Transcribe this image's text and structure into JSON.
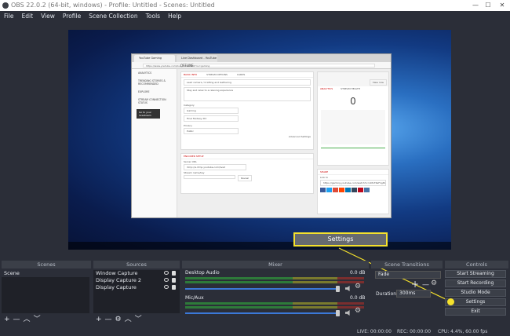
{
  "window": {
    "title": "OBS 22.0.2 (64-bit, windows) - Profile: Untitled - Scenes: Untitled",
    "minimize": "—",
    "maximize": "☐",
    "close": "✕"
  },
  "menu": [
    "File",
    "Edit",
    "View",
    "Profile",
    "Scene Collection",
    "Tools",
    "Help"
  ],
  "preview": {
    "tabs": [
      "YouTube Gaming",
      "Live Dashboard - YouTube"
    ],
    "url": "https://www.youtube.com/live_dashboard?nv=gaming",
    "sidebar": [
      "ANALYTICS",
      "TRENDING STORIES & RECOMMENDED",
      "EXPLORE",
      "STREAM CONNECTION STATUS"
    ],
    "sidebar_button": "Go to your livestream",
    "status": "OFFLINE",
    "main_tabs": [
      "BASIC INFO",
      "STREAM OPTIONS",
      "CARDS"
    ],
    "stream_title": "Lead camera / Crafting and Gathering",
    "stream_desc": "Stay and relax to a relaxing experience",
    "category_label": "Category",
    "category_value": "Gaming",
    "game_value": "Final Fantasy XIV",
    "privacy_label": "Privacy",
    "privacy_value": "Public",
    "advanced": "Advanced Settings",
    "encoder_header": "ENCODER SETUP",
    "server_url_label": "Server URL",
    "server_url": "rtmp://a.rtmp.youtube.com/live2",
    "stream_key_label": "Stream name/key",
    "reveal": "Reveal",
    "view_now": "View now",
    "analytics_tabs": [
      "ANALYTICS",
      "STREAM HEALTH"
    ],
    "viewers_value": "0",
    "share_label": "SHARE",
    "link_label": "Link to",
    "link_value": "https://gaming.youtube.com/watch?v=xMvTRsF1gPw"
  },
  "callout": {
    "label": "Settings"
  },
  "docks": {
    "scenes": {
      "title": "Scenes",
      "items": [
        "Scene"
      ]
    },
    "sources": {
      "title": "Sources",
      "items": [
        "Window Capture",
        "Display Capture 2",
        "Display Capture"
      ]
    },
    "mixer": {
      "title": "Mixer",
      "channels": [
        {
          "name": "Desktop Audio",
          "db": "0.0 dB",
          "level": 0.75
        },
        {
          "name": "Mic/Aux",
          "db": "0.0 dB",
          "level": 0.75
        }
      ]
    },
    "transitions": {
      "title": "Scene Transitions",
      "transition": "Fade",
      "duration_label": "Duration",
      "duration_value": "300ms"
    },
    "controls": {
      "title": "Controls",
      "buttons": [
        "Start Streaming",
        "Start Recording",
        "Studio Mode",
        "Settings",
        "Exit"
      ]
    }
  },
  "status": {
    "live": "LIVE: 00:00:00",
    "rec": "REC: 00:00:00",
    "cpu": "CPU: 4.4%, 60.00 fps"
  },
  "colors": {
    "highlight": "#f5e12c",
    "background": "#2b2e38"
  }
}
